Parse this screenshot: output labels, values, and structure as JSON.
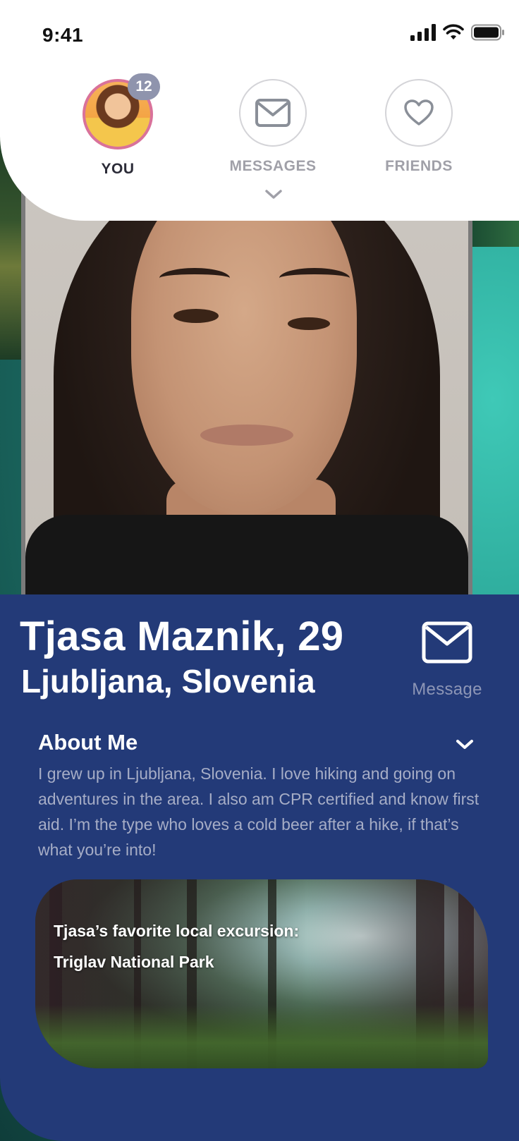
{
  "status_bar": {
    "time": "9:41"
  },
  "nav": {
    "you": {
      "label": "YOU",
      "badge": "12"
    },
    "messages": {
      "label": "MESSAGES"
    },
    "friends": {
      "label": "FRIENDS"
    }
  },
  "profile": {
    "name_age": "Tjasa Maznik, 29",
    "location": "Ljubljana, Slovenia",
    "message_label": "Message"
  },
  "about": {
    "title": "About Me",
    "text": "I grew up in Ljubljana, Slovenia. I love hiking and going on adventures in the area. I also am CPR certified and know first aid. I’m the type who loves a cold beer after a hike, if that’s what you’re into!"
  },
  "excursion": {
    "line1": "Tjasa’s favorite local excursion:",
    "line2": "Triglav National Park"
  },
  "colors": {
    "panel_blue": "#233a78",
    "avatar_ring": "#d9729a",
    "badge_bg": "#8f94ad",
    "muted_text": "#a6adc6",
    "lake_teal": "#2aa596"
  },
  "icons": {
    "signal": "cellular-signal-icon",
    "wifi": "wifi-icon",
    "battery": "battery-icon",
    "messages": "envelope-icon",
    "friends": "heart-icon",
    "nav_chevron": "chevron-down-icon",
    "message_button": "envelope-icon",
    "about_chevron": "chevron-down-icon"
  }
}
